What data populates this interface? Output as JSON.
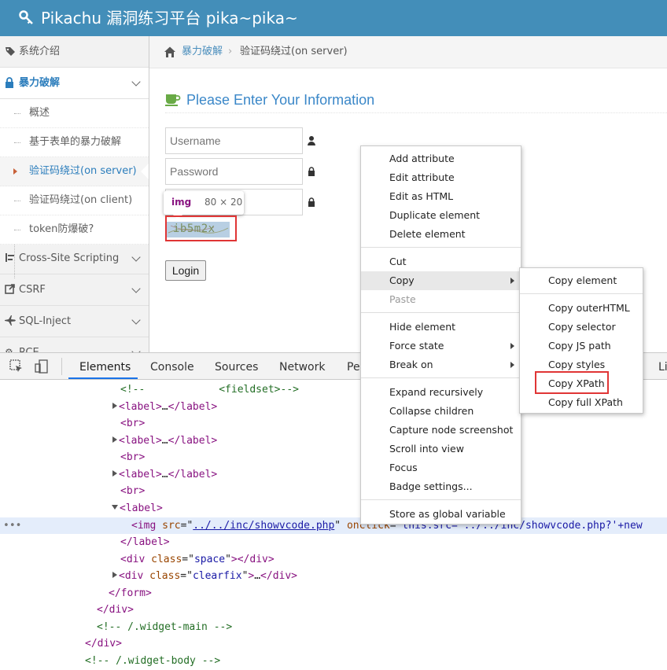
{
  "header": {
    "title": "Pikachu 漏洞练习平台 pika~pika~"
  },
  "sidebar": {
    "items": [
      {
        "label": "系统介绍",
        "icon": "tags-icon"
      },
      {
        "label": "暴力破解",
        "icon": "lock-icon"
      },
      {
        "label": "Cross-Site Scripting",
        "icon": "sliders-icon"
      },
      {
        "label": "CSRF",
        "icon": "share-icon"
      },
      {
        "label": "SQL-Inject",
        "icon": "plane-icon"
      },
      {
        "label": "RCE",
        "icon": "gear-icon"
      }
    ],
    "sub_items": [
      {
        "label": "概述"
      },
      {
        "label": "基于表单的暴力破解"
      },
      {
        "label": "验证码绕过(on server)"
      },
      {
        "label": "验证码绕过(on client)"
      },
      {
        "label": "token防爆破?"
      }
    ]
  },
  "breadcrumb": {
    "parent": "暴力破解",
    "current": "验证码绕过(on server)"
  },
  "main": {
    "heading": "Please Enter Your Information",
    "username_placeholder": "Username",
    "password_placeholder": "Password",
    "captcha_text": "ib5m2x",
    "login_label": "Login",
    "tooltip_tag": "img",
    "tooltip_size": "80 × 20"
  },
  "devtools": {
    "tabs": [
      "Elements",
      "Console",
      "Sources",
      "Network",
      "Pe",
      "Li"
    ],
    "lines": {
      "l0": "<!--            <fieldset>-->",
      "label": "label",
      "br": "br",
      "img_src": "../../inc/showvcode.php",
      "onclick_val": "this.src='../../inc/showvcode.php?'+new",
      "div_space": "space",
      "div_clearfix": "clearfix",
      "com_widget_main": "<!-- /.widget-main -->",
      "com_widget_body": "<!-- /.widget-body -->"
    }
  },
  "context_menu": {
    "group1": [
      "Add attribute",
      "Edit attribute",
      "Edit as HTML",
      "Duplicate element",
      "Delete element"
    ],
    "group2": [
      "Cut",
      "Copy",
      "Paste"
    ],
    "group3": [
      "Hide element",
      "Force state",
      "Break on"
    ],
    "group4": [
      "Expand recursively",
      "Collapse children",
      "Capture node screenshot",
      "Scroll into view",
      "Focus",
      "Badge settings..."
    ],
    "group5": [
      "Store as global variable"
    ]
  },
  "copy_submenu": {
    "items": [
      "Copy element",
      "Copy outerHTML",
      "Copy selector",
      "Copy JS path",
      "Copy styles",
      "Copy XPath",
      "Copy full XPath"
    ]
  }
}
